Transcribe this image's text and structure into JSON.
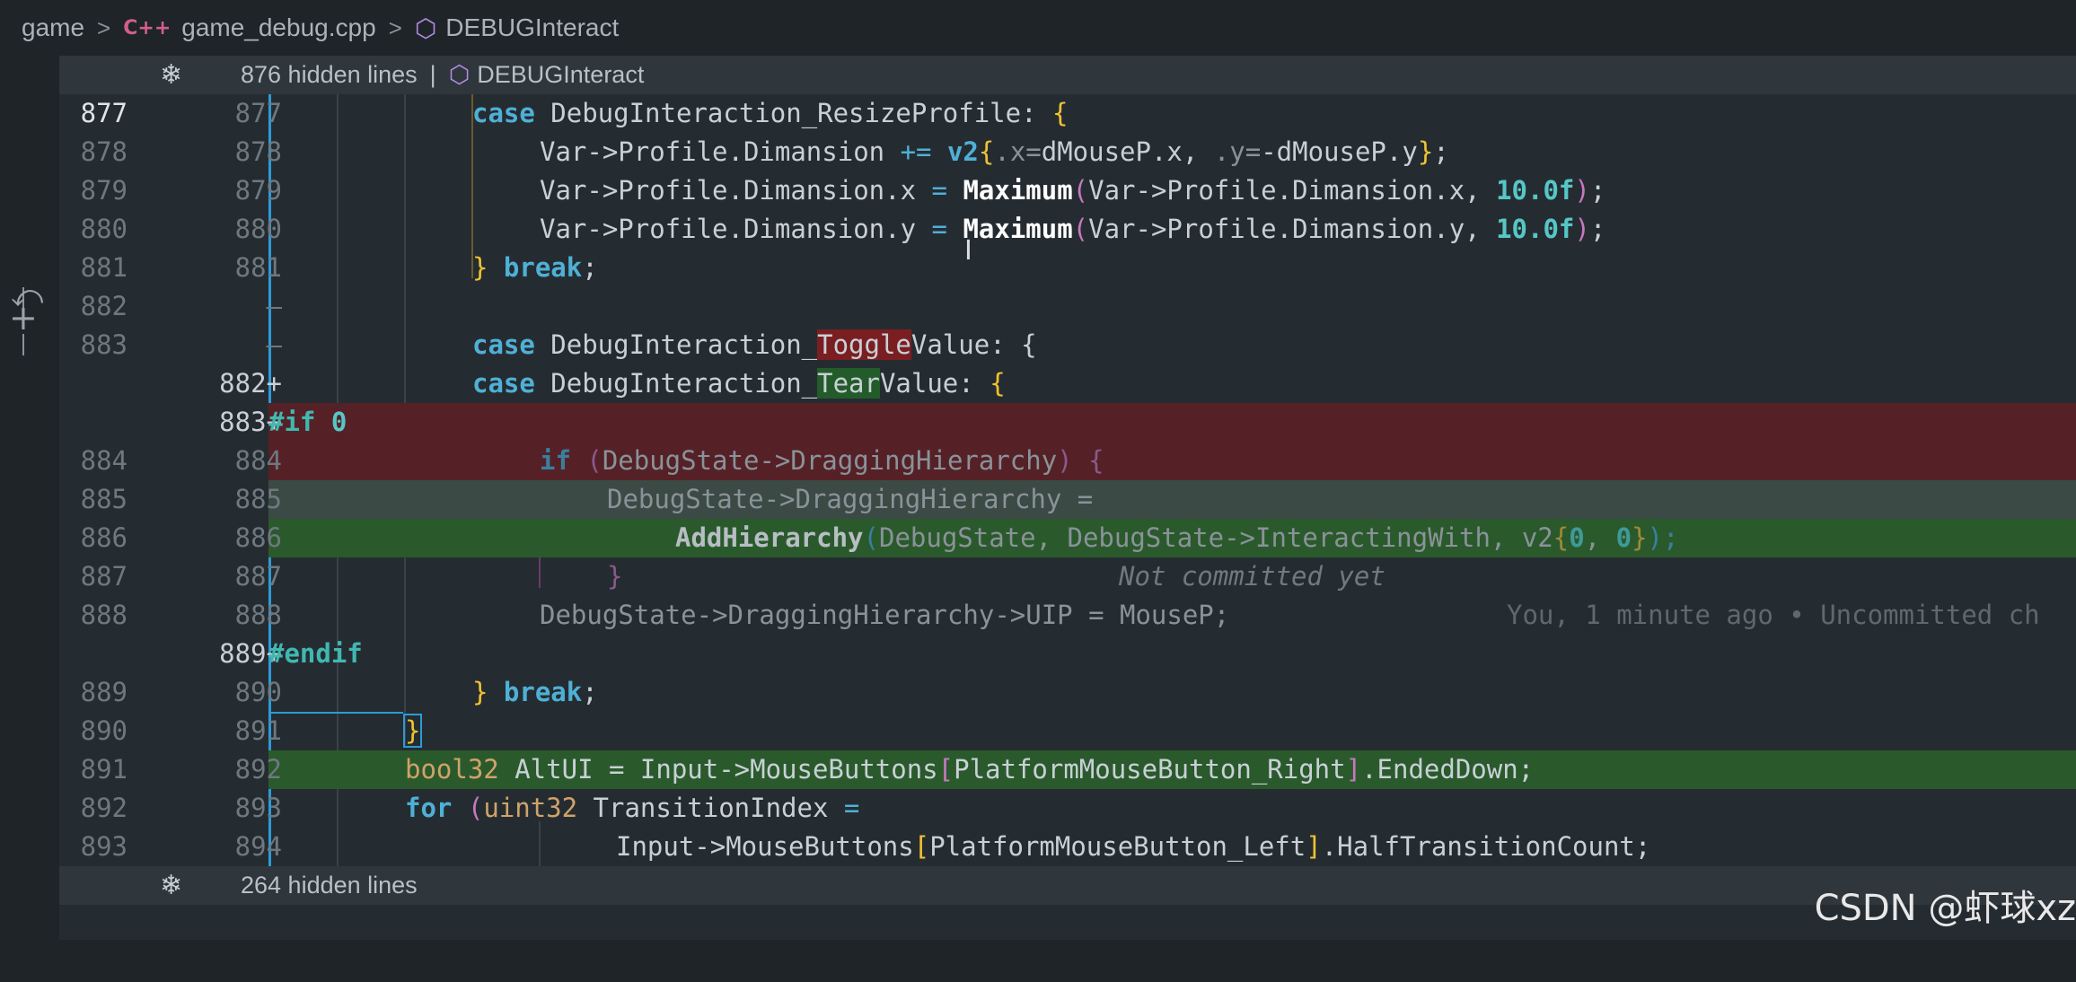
{
  "breadcrumb": {
    "folder": "game",
    "lang_badge": "C++",
    "file": "game_debug.cpp",
    "symbol": "DEBUGInteract"
  },
  "top_hidden": {
    "count_text": "876 hidden lines",
    "symbol": "DEBUGInteract"
  },
  "bottom_hidden": {
    "count_text": "264 hidden lines"
  },
  "lines": [
    {
      "o": "877",
      "n": "877"
    },
    {
      "o": "878",
      "n": "878"
    },
    {
      "o": "879",
      "n": "879"
    },
    {
      "o": "880",
      "n": "880"
    },
    {
      "o": "881",
      "n": "881"
    },
    {
      "o": "882",
      "n": "—"
    },
    {
      "o": "883",
      "n": "—"
    },
    {
      "o": "",
      "n": "882+"
    },
    {
      "o": "",
      "n": "883+"
    },
    {
      "o": "884",
      "n": "884"
    },
    {
      "o": "885",
      "n": "885"
    },
    {
      "o": "886",
      "n": "886"
    },
    {
      "o": "887",
      "n": "887"
    },
    {
      "o": "888",
      "n": "888"
    },
    {
      "o": "",
      "n": "889+"
    },
    {
      "o": "889",
      "n": "890"
    },
    {
      "o": "890",
      "n": "891"
    },
    {
      "o": "891",
      "n": "892"
    },
    {
      "o": "892",
      "n": "893"
    },
    {
      "o": "893",
      "n": "894"
    }
  ],
  "blame": {
    "text": "Not committed yet",
    "detail": "You, 1 minute ago • Uncommitted ch"
  },
  "code": {
    "l877": {
      "kw": "case",
      "name": " DebugInteraction_ResizeProfile: ",
      "br": "{"
    },
    "l878": {
      "a": "Var->Profile.Dimansion ",
      "op": "+=",
      "sp": " ",
      "fn": "v2",
      "b1": "{",
      ".x": ".x=",
      "v1": "dMouseP.x, ",
      ".y": ".y=",
      "v2": "-dMouseP.y",
      "b2": "}",
      ";": ";"
    },
    "l879": {
      "a": "Var->Profile.Dimansion.x ",
      "op": "=",
      "sp": " ",
      "fn": "Maximum",
      "p1": "(",
      "b": "Var->Profile.Dimansion.x, ",
      "num": "10.0f",
      "p2": ")",
      ";": ";"
    },
    "l880": {
      "a": "Var->Profile.Dimansion.y ",
      "op": "=",
      "sp": " ",
      "fn": "Maximum",
      "p1": "(",
      "b": "Var->Profile.Dimansion.y, ",
      "num": "10.0f",
      "p2": ")",
      ";": ";"
    },
    "l881": {
      "br": "}",
      "kw": " break",
      ";": ";"
    },
    "l883": {
      "kw": "case",
      "a": " DebugInteraction_",
      "hl": "Toggle",
      "b": "Value: {"
    },
    "l882n": {
      "kw": "case",
      "a": " DebugInteraction_",
      "hl": "Tear",
      "b": "Value: ",
      "br": "{"
    },
    "l883n": {
      "pp": "#if",
      "num": " 0"
    },
    "l884": {
      "kw": "if",
      "p": " (",
      "a": "DebugState->DraggingHierarchy",
      "p2": ") {"
    },
    "l885": {
      "a": "DebugState->DraggingHierarchy ="
    },
    "l886": {
      "fn": "AddHierarchy",
      "p1": "(",
      "a": "DebugState, DebugState->InteractingWith, v2",
      "b1": "{",
      "n1": "0",
      "c": ", ",
      "n2": "0",
      "b2": "}",
      "p2": ");"
    },
    "l887": {
      "p": "}"
    },
    "l888": {
      "a": "DebugState->DraggingHierarchy->UIP = MouseP;"
    },
    "l889n": {
      "pp": "#endif"
    },
    "l890": {
      "br": "}",
      "kw": " break",
      ";": ";"
    },
    "l891": {
      "br": "}"
    },
    "l892": {
      "ty": "bool32",
      "a": " AltUI = Input->MouseButtons",
      "b1": "[",
      "b": "PlatformMouseButton_Right",
      "b2": "]",
      "c": ".EndedDown;"
    },
    "l893": {
      "kw": "for",
      "p": " (",
      "ty": "uint32",
      "a": " TransitionIndex ",
      "op": "="
    },
    "l894": {
      "a": "Input->MouseButtons",
      "b1": "[",
      "b": "PlatformMouseButton_Left",
      "b2": "]",
      "c": ".HalfTransitionCount;"
    }
  },
  "watermark": "CSDN @虾球xz",
  "colors": {
    "deleted_bg": "#552127",
    "added_bg": "#2a5a2c",
    "keyword": "#4fb0d6",
    "brace": "#f0c232"
  }
}
